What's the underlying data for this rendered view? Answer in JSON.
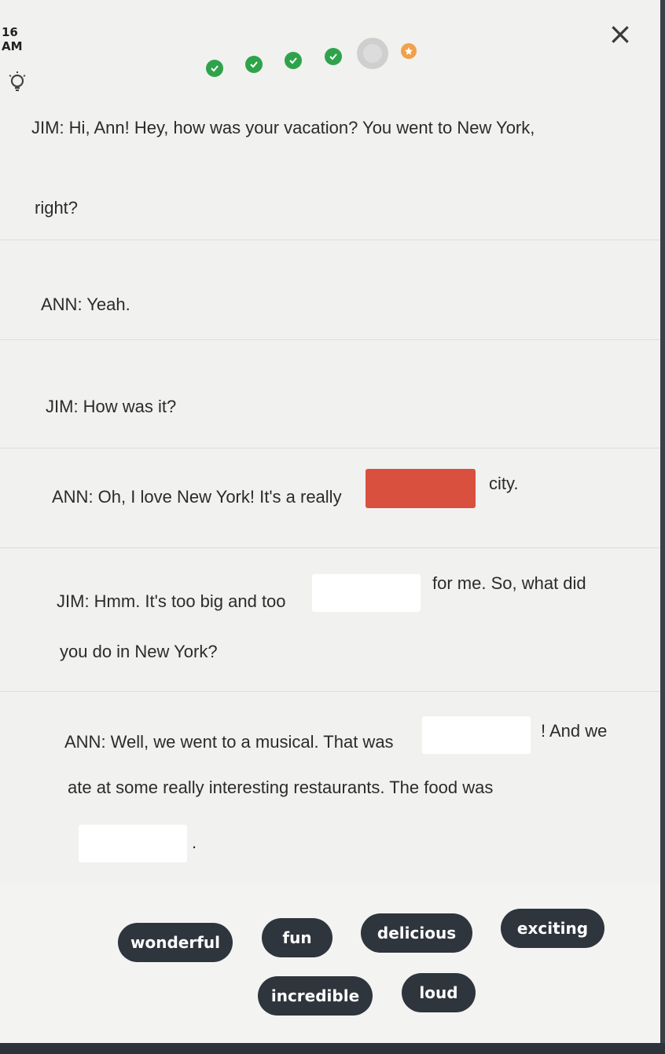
{
  "status_bar": {
    "time": "16 AM"
  },
  "header": {
    "close_glyph": "×",
    "hint_icon": "lightbulb-icon",
    "progress": {
      "completed_steps": 4,
      "current_step": 5,
      "total_steps": 6,
      "final_step_icon": "star-icon"
    }
  },
  "dialogue": {
    "line1": {
      "text_a": "JIM: Hi, Ann! Hey, how was your vacation? You went to New York,",
      "text_b": "right?"
    },
    "line2": {
      "text": "ANN: Yeah."
    },
    "line3": {
      "text": "JIM: How was it?"
    },
    "line4": {
      "before": "ANN: Oh, I love New York! It's a really",
      "after": "city."
    },
    "line5": {
      "before": "JIM: Hmm. It's too big and too",
      "after": "for me. So, what did",
      "text_b": "you do in New York?"
    },
    "line6": {
      "before": "ANN: Well, we went to a musical. That was",
      "after": "! And we",
      "text_b": "ate at some really interesting restaurants. The food was",
      "end": "."
    }
  },
  "word_bank": [
    "wonderful",
    "fun",
    "delicious",
    "exciting",
    "incredible",
    "loud"
  ],
  "colors": {
    "accent_green": "#2fa34b",
    "active_blank": "#d9503e",
    "chip_bg": "#2f353d",
    "star": "#f0a14a"
  }
}
